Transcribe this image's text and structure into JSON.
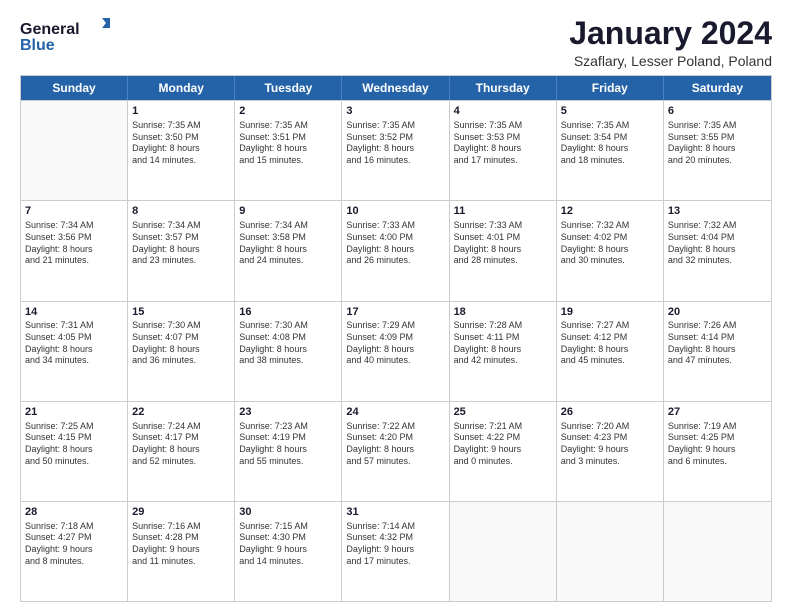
{
  "logo": {
    "line1": "General",
    "line2": "Blue"
  },
  "title": "January 2024",
  "subtitle": "Szaflary, Lesser Poland, Poland",
  "header_days": [
    "Sunday",
    "Monday",
    "Tuesday",
    "Wednesday",
    "Thursday",
    "Friday",
    "Saturday"
  ],
  "weeks": [
    [
      {
        "day": "",
        "info": ""
      },
      {
        "day": "1",
        "info": "Sunrise: 7:35 AM\nSunset: 3:50 PM\nDaylight: 8 hours\nand 14 minutes."
      },
      {
        "day": "2",
        "info": "Sunrise: 7:35 AM\nSunset: 3:51 PM\nDaylight: 8 hours\nand 15 minutes."
      },
      {
        "day": "3",
        "info": "Sunrise: 7:35 AM\nSunset: 3:52 PM\nDaylight: 8 hours\nand 16 minutes."
      },
      {
        "day": "4",
        "info": "Sunrise: 7:35 AM\nSunset: 3:53 PM\nDaylight: 8 hours\nand 17 minutes."
      },
      {
        "day": "5",
        "info": "Sunrise: 7:35 AM\nSunset: 3:54 PM\nDaylight: 8 hours\nand 18 minutes."
      },
      {
        "day": "6",
        "info": "Sunrise: 7:35 AM\nSunset: 3:55 PM\nDaylight: 8 hours\nand 20 minutes."
      }
    ],
    [
      {
        "day": "7",
        "info": "Sunrise: 7:34 AM\nSunset: 3:56 PM\nDaylight: 8 hours\nand 21 minutes."
      },
      {
        "day": "8",
        "info": "Sunrise: 7:34 AM\nSunset: 3:57 PM\nDaylight: 8 hours\nand 23 minutes."
      },
      {
        "day": "9",
        "info": "Sunrise: 7:34 AM\nSunset: 3:58 PM\nDaylight: 8 hours\nand 24 minutes."
      },
      {
        "day": "10",
        "info": "Sunrise: 7:33 AM\nSunset: 4:00 PM\nDaylight: 8 hours\nand 26 minutes."
      },
      {
        "day": "11",
        "info": "Sunrise: 7:33 AM\nSunset: 4:01 PM\nDaylight: 8 hours\nand 28 minutes."
      },
      {
        "day": "12",
        "info": "Sunrise: 7:32 AM\nSunset: 4:02 PM\nDaylight: 8 hours\nand 30 minutes."
      },
      {
        "day": "13",
        "info": "Sunrise: 7:32 AM\nSunset: 4:04 PM\nDaylight: 8 hours\nand 32 minutes."
      }
    ],
    [
      {
        "day": "14",
        "info": "Sunrise: 7:31 AM\nSunset: 4:05 PM\nDaylight: 8 hours\nand 34 minutes."
      },
      {
        "day": "15",
        "info": "Sunrise: 7:30 AM\nSunset: 4:07 PM\nDaylight: 8 hours\nand 36 minutes."
      },
      {
        "day": "16",
        "info": "Sunrise: 7:30 AM\nSunset: 4:08 PM\nDaylight: 8 hours\nand 38 minutes."
      },
      {
        "day": "17",
        "info": "Sunrise: 7:29 AM\nSunset: 4:09 PM\nDaylight: 8 hours\nand 40 minutes."
      },
      {
        "day": "18",
        "info": "Sunrise: 7:28 AM\nSunset: 4:11 PM\nDaylight: 8 hours\nand 42 minutes."
      },
      {
        "day": "19",
        "info": "Sunrise: 7:27 AM\nSunset: 4:12 PM\nDaylight: 8 hours\nand 45 minutes."
      },
      {
        "day": "20",
        "info": "Sunrise: 7:26 AM\nSunset: 4:14 PM\nDaylight: 8 hours\nand 47 minutes."
      }
    ],
    [
      {
        "day": "21",
        "info": "Sunrise: 7:25 AM\nSunset: 4:15 PM\nDaylight: 8 hours\nand 50 minutes."
      },
      {
        "day": "22",
        "info": "Sunrise: 7:24 AM\nSunset: 4:17 PM\nDaylight: 8 hours\nand 52 minutes."
      },
      {
        "day": "23",
        "info": "Sunrise: 7:23 AM\nSunset: 4:19 PM\nDaylight: 8 hours\nand 55 minutes."
      },
      {
        "day": "24",
        "info": "Sunrise: 7:22 AM\nSunset: 4:20 PM\nDaylight: 8 hours\nand 57 minutes."
      },
      {
        "day": "25",
        "info": "Sunrise: 7:21 AM\nSunset: 4:22 PM\nDaylight: 9 hours\nand 0 minutes."
      },
      {
        "day": "26",
        "info": "Sunrise: 7:20 AM\nSunset: 4:23 PM\nDaylight: 9 hours\nand 3 minutes."
      },
      {
        "day": "27",
        "info": "Sunrise: 7:19 AM\nSunset: 4:25 PM\nDaylight: 9 hours\nand 6 minutes."
      }
    ],
    [
      {
        "day": "28",
        "info": "Sunrise: 7:18 AM\nSunset: 4:27 PM\nDaylight: 9 hours\nand 8 minutes."
      },
      {
        "day": "29",
        "info": "Sunrise: 7:16 AM\nSunset: 4:28 PM\nDaylight: 9 hours\nand 11 minutes."
      },
      {
        "day": "30",
        "info": "Sunrise: 7:15 AM\nSunset: 4:30 PM\nDaylight: 9 hours\nand 14 minutes."
      },
      {
        "day": "31",
        "info": "Sunrise: 7:14 AM\nSunset: 4:32 PM\nDaylight: 9 hours\nand 17 minutes."
      },
      {
        "day": "",
        "info": ""
      },
      {
        "day": "",
        "info": ""
      },
      {
        "day": "",
        "info": ""
      }
    ]
  ]
}
